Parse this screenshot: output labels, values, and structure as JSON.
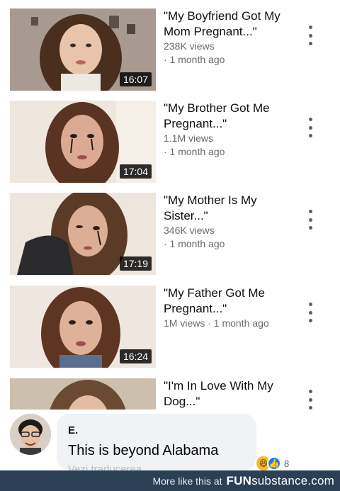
{
  "videos": [
    {
      "title": "\"My Boyfriend Got My Mom Pregnant...\"",
      "views": "238K views",
      "age": "· 1 month ago",
      "duration": "16:07"
    },
    {
      "title": "\"My Brother Got Me Pregnant...\"",
      "views": "1.1M views",
      "age": "· 1 month ago",
      "duration": "17:04"
    },
    {
      "title": "\"My Mother Is My Sister...\"",
      "views": "346K views",
      "age": "· 1 month ago",
      "duration": "17:19"
    },
    {
      "title": "\"My Father Got Me Pregnant...\"",
      "views": "1M views",
      "age": "· 1 month ago",
      "duration": "16:24"
    },
    {
      "title": "\"I'm In Love With My Dog...\"",
      "views": "",
      "age": "",
      "duration": ""
    }
  ],
  "comment": {
    "author": "E.",
    "text": "This is beyond Alabama",
    "translate": "Vezi traducerea",
    "reaction_count": "8"
  },
  "footer": {
    "more_text": "More like this at",
    "brand_bold": "FUN",
    "brand_rest": "substance.com"
  },
  "colors": {
    "footer_bg": "#2b3f55",
    "bubble_bg": "#f0f2f5",
    "duration_bg": "#000000",
    "like": "#2078f4",
    "haha": "#f7b928"
  },
  "icons": [
    "more-vert-icon",
    "haha-reaction-icon",
    "like-reaction-icon",
    "avatar-image"
  ]
}
